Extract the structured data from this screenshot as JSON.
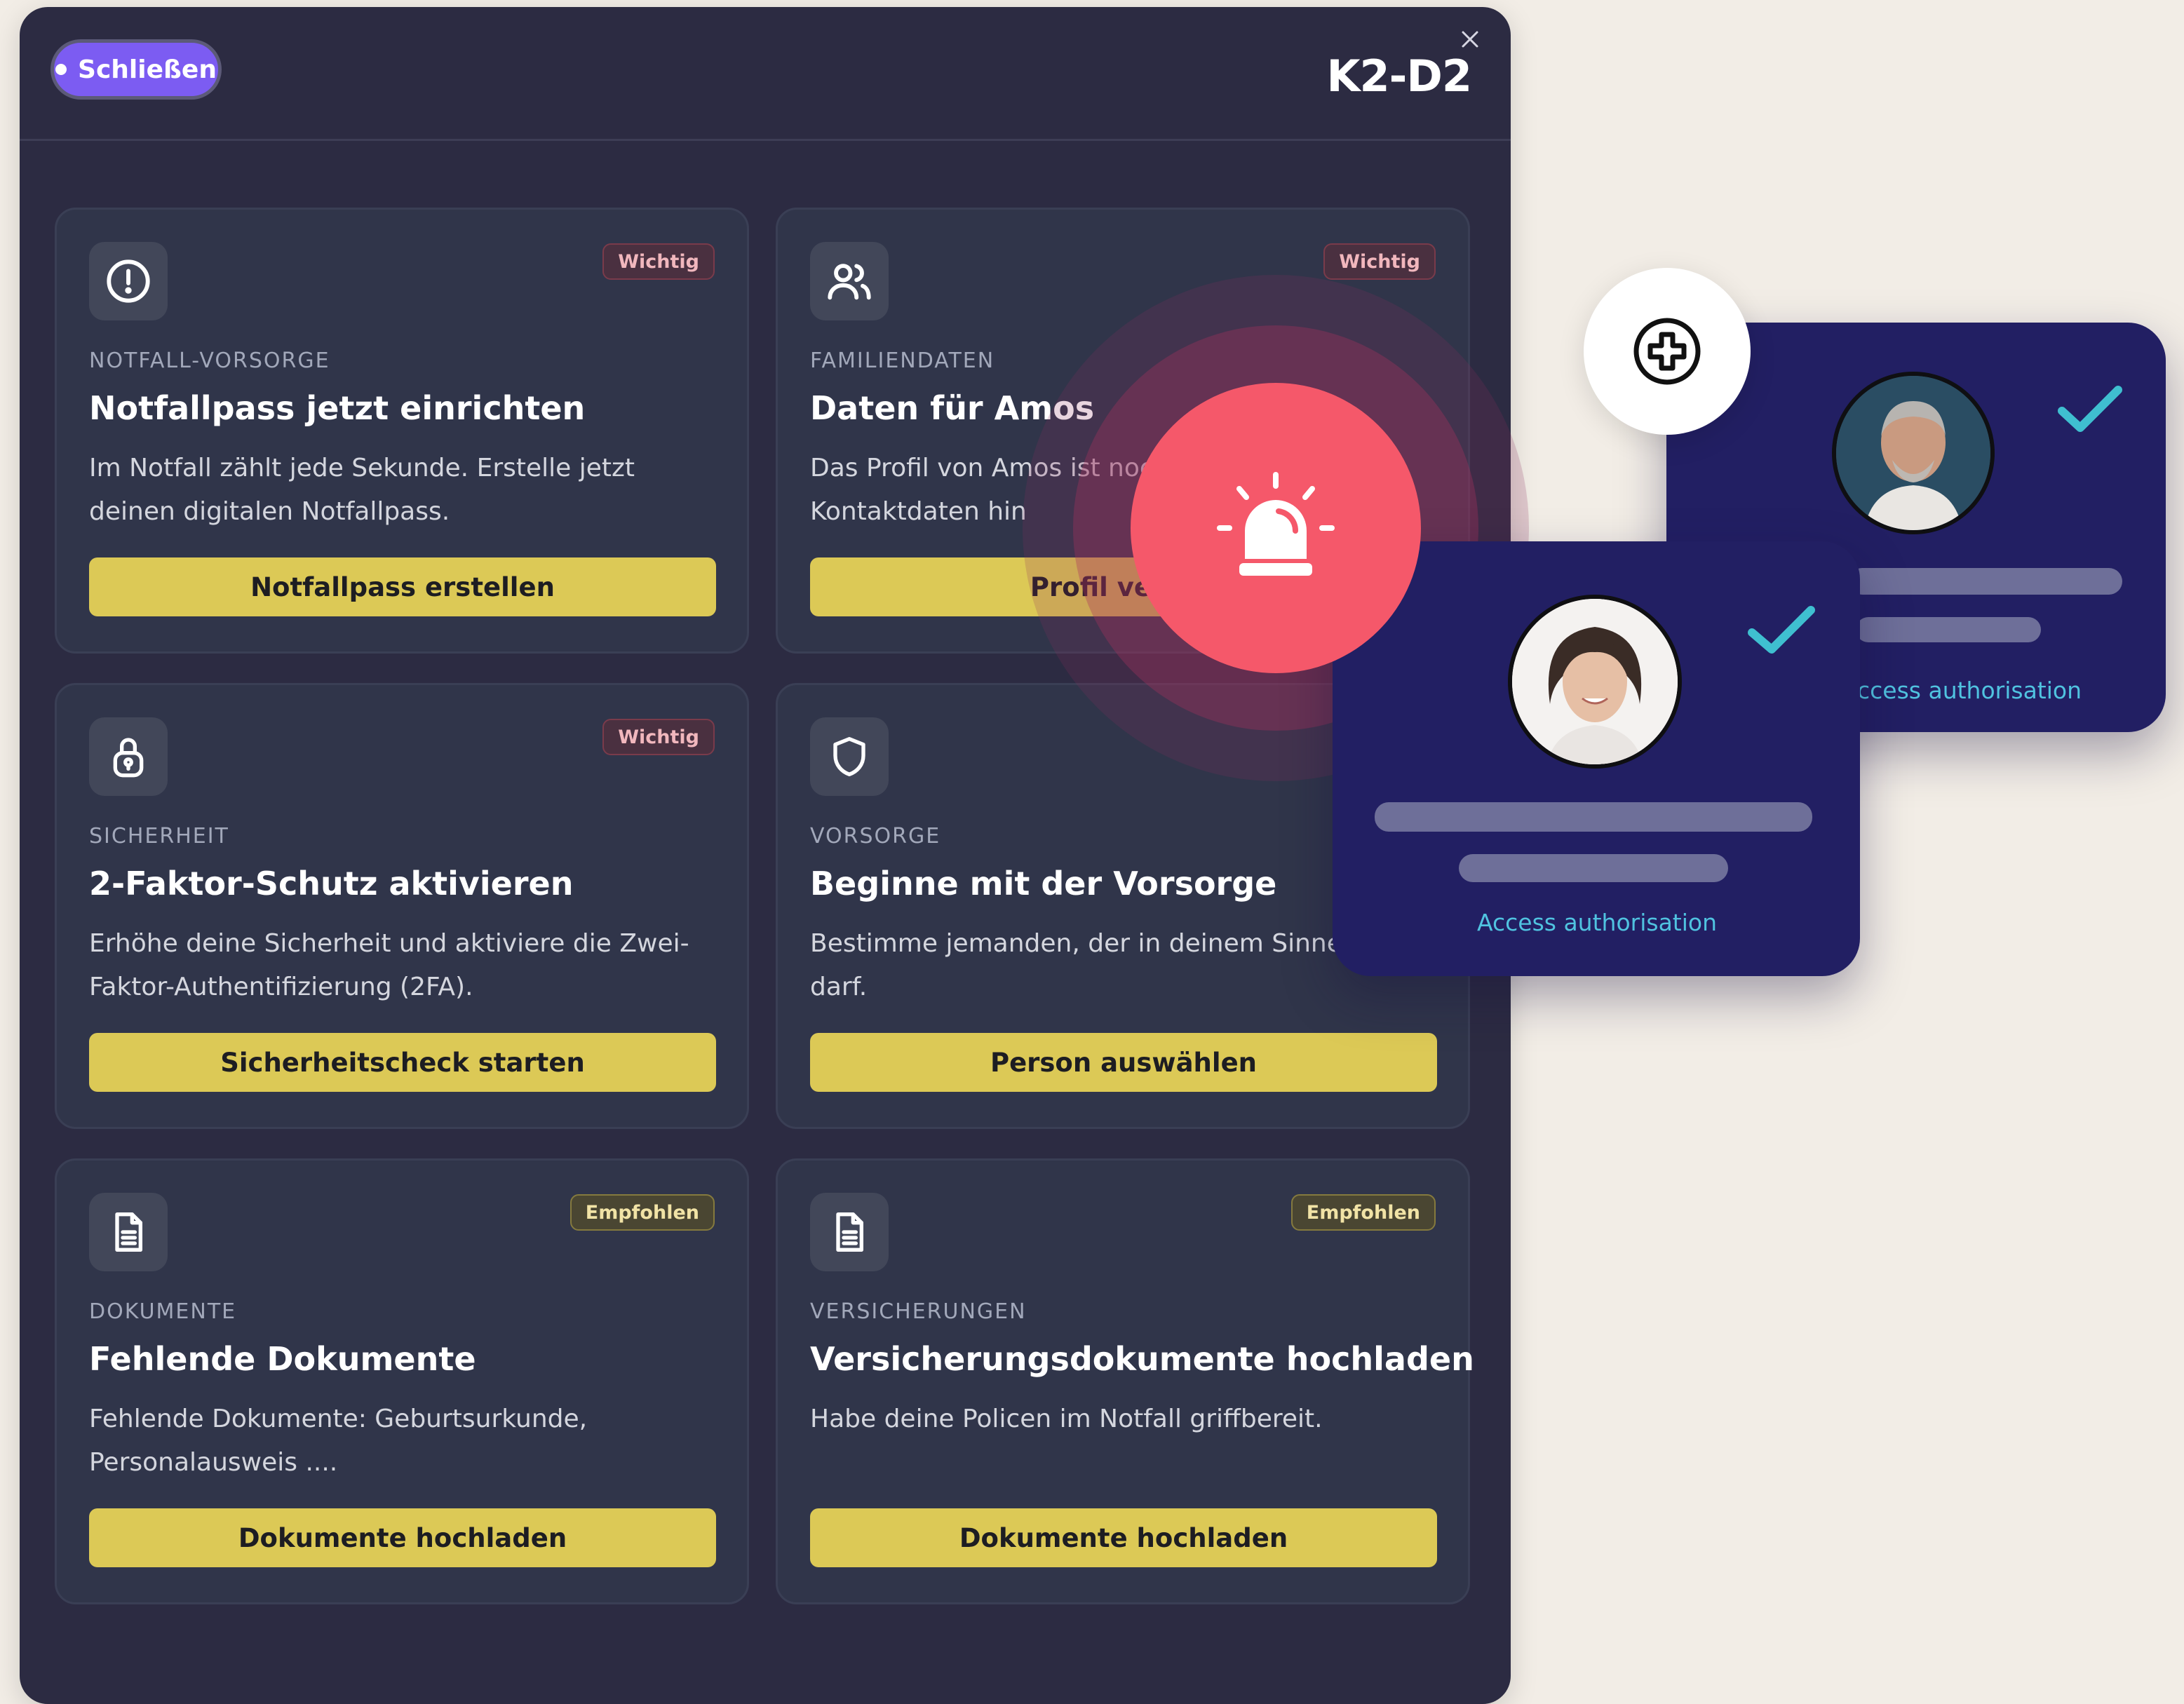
{
  "header": {
    "close_label": "Schließen",
    "app_title": "K2-D2"
  },
  "cards": [
    {
      "badge": "Wichtig",
      "category": "NOTFALL-VORSORGE",
      "title": "Notfallpass jetzt einrichten",
      "desc": "Im Notfall zählt jede Sekunde. Erstelle jetzt deinen digitalen Notfallpass.",
      "action": "Notfallpass erstellen",
      "icon": "alert-circle-icon"
    },
    {
      "badge": "Wichtig",
      "category": "FAMILIENDATEN",
      "title": "Daten für Amos",
      "desc": "Das Profil von Amos ist noc fehlende Kontaktdaten hin",
      "action": "Profil vervoll",
      "icon": "users-icon"
    },
    {
      "badge": "Wichtig",
      "category": "SICHERHEIT",
      "title": "2-Faktor-Schutz aktivieren",
      "desc": "Erhöhe deine Sicherheit und aktiviere die Zwei-Faktor-Authentifizierung (2FA).",
      "action": "Sicherheitscheck starten",
      "icon": "lock-icon"
    },
    {
      "badge": "",
      "category": "VORSORGE",
      "title": "Beginne mit der Vorsorge",
      "desc": "Bestimme jemanden, der in deinem Sinne ha darf.",
      "action": "Person auswählen",
      "icon": "shield-icon"
    },
    {
      "badge": "Empfohlen",
      "category": "DOKUMENTE",
      "title": "Fehlende Dokumente",
      "desc": "Fehlende Dokumente: Geburtsurkunde, Personalausweis ....",
      "action": "Dokumente hochladen",
      "icon": "document-icon"
    },
    {
      "badge": "Empfohlen",
      "category": "VERSICHERUNGEN",
      "title": "Versicherungsdokumente hochladen",
      "desc": "Habe deine Policen im Notfall griffbereit.",
      "action": "Dokumente hochladen",
      "icon": "document-icon"
    }
  ],
  "overlay": {
    "auth_back_label": "ccess authorisation",
    "auth_front_label": "Access authorisation",
    "alarm_icon": "siren-icon",
    "medic_icon": "medical-cross-icon"
  },
  "colors": {
    "panel_bg": "#2c2b42",
    "card_bg": "#30354a",
    "action_yellow": "#dcc956",
    "accent_purple": "#7c5cf2",
    "alarm_red": "#f5586a",
    "auth_card_bg": "#221f63",
    "check_teal": "#3fbfd0"
  }
}
